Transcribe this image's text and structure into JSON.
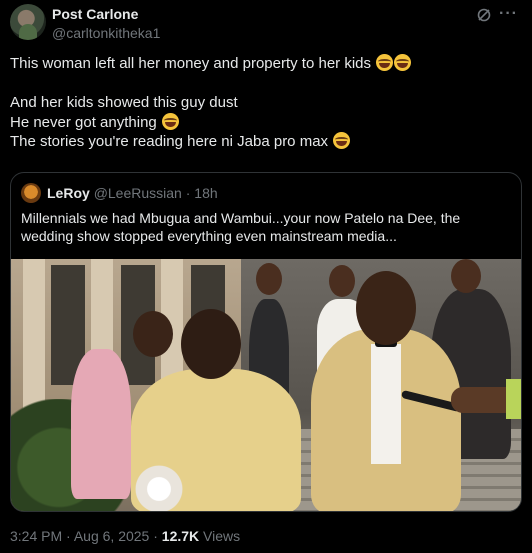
{
  "author": {
    "name": "Post Carlone",
    "handle": "@carltonkitheka1"
  },
  "icons": {
    "grok": "grok-icon",
    "more": "more-icon"
  },
  "post": {
    "lines": [
      "This woman left all her money and property to her kids",
      "",
      "And her kids showed this guy dust",
      "He never got anything",
      "The stories you're reading here ni Jaba pro max"
    ]
  },
  "quote": {
    "name": "LeRoy",
    "handle": "@LeeRussian",
    "separator": "·",
    "time": "18h",
    "text": "Millennials we had Mbugua and Wambui...your now Patelo na Dee, the wedding show stopped everything even mainstream media..."
  },
  "footer": {
    "time": "3:24 PM",
    "dot": "·",
    "date": "Aug 6, 2025",
    "views_count": "12.7K",
    "views_label": "Views"
  },
  "colors": {
    "background": "#000000",
    "text": "#e7e9ea",
    "muted": "#71767b",
    "border": "#2f3336"
  }
}
